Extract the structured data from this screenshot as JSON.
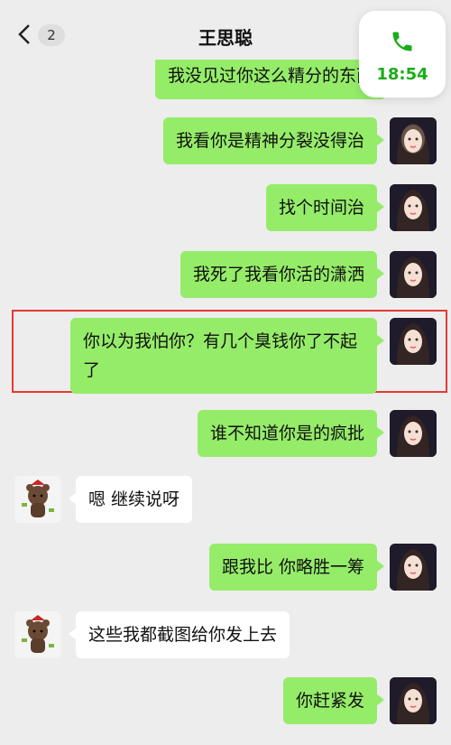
{
  "header": {
    "back_label": "<",
    "unread_count": "2",
    "title": "王思聪"
  },
  "call_widget": {
    "time": "18:54"
  },
  "messages": [
    {
      "side": "right",
      "text": "我没见过你这么精分的东西"
    },
    {
      "side": "right",
      "text": "我看你是精神分裂没得治"
    },
    {
      "side": "right",
      "text": "找个时间治"
    },
    {
      "side": "right",
      "text": "我死了我看你活的潇洒"
    },
    {
      "side": "right",
      "text": "你以为我怕你？有几个臭钱你了不起了",
      "highlighted": true
    },
    {
      "side": "right",
      "text": "谁不知道你是的疯批"
    },
    {
      "side": "left",
      "text": "嗯 继续说呀"
    },
    {
      "side": "right",
      "text": "跟我比 你略胜一筹"
    },
    {
      "side": "left",
      "text": "这些我都截图给你发上去"
    },
    {
      "side": "right",
      "text": "你赶紧发"
    }
  ],
  "colors": {
    "sent_bubble": "#95ec69",
    "received_bubble": "#ffffff",
    "background": "#ededed",
    "call_accent": "#1aad19",
    "highlight_border": "#e53935"
  }
}
